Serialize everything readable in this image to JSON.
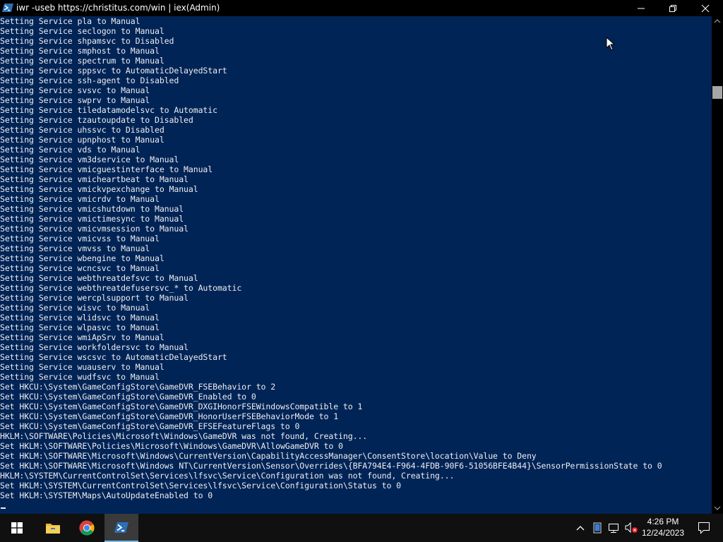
{
  "window": {
    "title": "iwr -useb https://christitus.com/win | iex(Admin)"
  },
  "console": {
    "lines": [
      "Setting Service pla to Manual",
      "Setting Service seclogon to Manual",
      "Setting Service shpamsvc to Disabled",
      "Setting Service smphost to Manual",
      "Setting Service spectrum to Manual",
      "Setting Service sppsvc to AutomaticDelayedStart",
      "Setting Service ssh-agent to Disabled",
      "Setting Service svsvc to Manual",
      "Setting Service swprv to Manual",
      "Setting Service tiledatamodelsvc to Automatic",
      "Setting Service tzautoupdate to Disabled",
      "Setting Service uhssvc to Disabled",
      "Setting Service upnphost to Manual",
      "Setting Service vds to Manual",
      "Setting Service vm3dservice to Manual",
      "Setting Service vmicguestinterface to Manual",
      "Setting Service vmicheartbeat to Manual",
      "Setting Service vmickvpexchange to Manual",
      "Setting Service vmicrdv to Manual",
      "Setting Service vmicshutdown to Manual",
      "Setting Service vmictimesync to Manual",
      "Setting Service vmicvmsession to Manual",
      "Setting Service vmicvss to Manual",
      "Setting Service vmvss to Manual",
      "Setting Service wbengine to Manual",
      "Setting Service wcncsvc to Manual",
      "Setting Service webthreatdefsvc to Manual",
      "Setting Service webthreatdefusersvc_* to Automatic",
      "Setting Service wercplsupport to Manual",
      "Setting Service wisvc to Manual",
      "Setting Service wlidsvc to Manual",
      "Setting Service wlpasvc to Manual",
      "Setting Service wmiApSrv to Manual",
      "Setting Service workfoldersvc to Manual",
      "Setting Service wscsvc to AutomaticDelayedStart",
      "Setting Service wuauserv to Manual",
      "Setting Service wudfsvc to Manual",
      "Set HKCU:\\System\\GameConfigStore\\GameDVR_FSEBehavior to 2",
      "Set HKCU:\\System\\GameConfigStore\\GameDVR_Enabled to 0",
      "Set HKCU:\\System\\GameConfigStore\\GameDVR_DXGIHonorFSEWindowsCompatible to 1",
      "Set HKCU:\\System\\GameConfigStore\\GameDVR_HonorUserFSEBehaviorMode to 1",
      "Set HKCU:\\System\\GameConfigStore\\GameDVR_EFSEFeatureFlags to 0",
      "HKLM:\\SOFTWARE\\Policies\\Microsoft\\Windows\\GameDVR was not found, Creating...",
      "Set HKLM:\\SOFTWARE\\Policies\\Microsoft\\Windows\\GameDVR\\AllowGameDVR to 0",
      "Set HKLM:\\SOFTWARE\\Microsoft\\Windows\\CurrentVersion\\CapabilityAccessManager\\ConsentStore\\location\\Value to Deny",
      "Set HKLM:\\SOFTWARE\\Microsoft\\Windows NT\\CurrentVersion\\Sensor\\Overrides\\{BFA794E4-F964-4FDB-90F6-51056BFE4B44}\\SensorPermissionState to 0",
      "HKLM:\\SYSTEM\\CurrentControlSet\\Services\\lfsvc\\Service\\Configuration was not found, Creating...",
      "Set HKLM:\\SYSTEM\\CurrentControlSet\\Services\\lfsvc\\Service\\Configuration\\Status to 0",
      "Set HKLM:\\SYSTEM\\Maps\\AutoUpdateEnabled to 0"
    ],
    "background": "#012456",
    "foreground": "#eeedf0"
  },
  "taskbar": {
    "apps": [
      {
        "name": "windows-start-icon"
      },
      {
        "name": "file-explorer-icon"
      },
      {
        "name": "chrome-icon"
      },
      {
        "name": "powershell-icon",
        "active": true
      }
    ],
    "clock": {
      "time": "4:26 PM",
      "date": "12/24/2023"
    },
    "tray_icons": [
      "chevron-up-icon",
      "tablet-icon",
      "network-icon",
      "volume-muted-icon",
      "notification-icon"
    ]
  }
}
